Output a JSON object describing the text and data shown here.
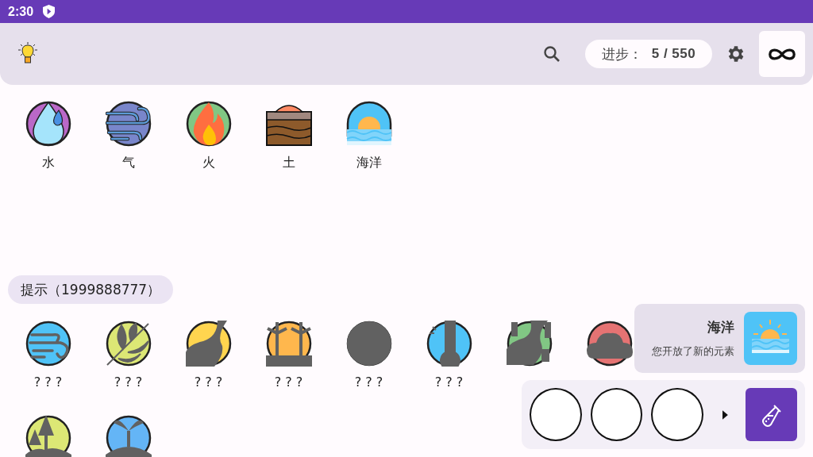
{
  "status_bar": {
    "time": "2:30"
  },
  "toolbar": {
    "progress_label": "进步：",
    "progress_value": "5 / 550"
  },
  "discovered": [
    {
      "name": "水"
    },
    {
      "name": "气"
    },
    {
      "name": "火"
    },
    {
      "name": "土"
    },
    {
      "name": "海洋"
    }
  ],
  "hint_button": {
    "label": "提示（1999888777）"
  },
  "hints": [
    {
      "label": "? ? ?",
      "color": "#4fc3f7"
    },
    {
      "label": "? ? ?",
      "color": "#dce775"
    },
    {
      "label": "? ? ?",
      "color": "#ffd54f"
    },
    {
      "label": "? ? ?",
      "color": "#ffb74d"
    },
    {
      "label": "? ? ?",
      "color": "#616161"
    },
    {
      "label": "? ? ?",
      "color": "#4fc3f7"
    },
    {
      "color": "#81c784"
    },
    {
      "color": "#e57373"
    },
    {
      "color": "#dce775"
    },
    {
      "color": "#64b5f6"
    }
  ],
  "toast": {
    "title": "海洋",
    "message": "您开放了新的元素"
  }
}
